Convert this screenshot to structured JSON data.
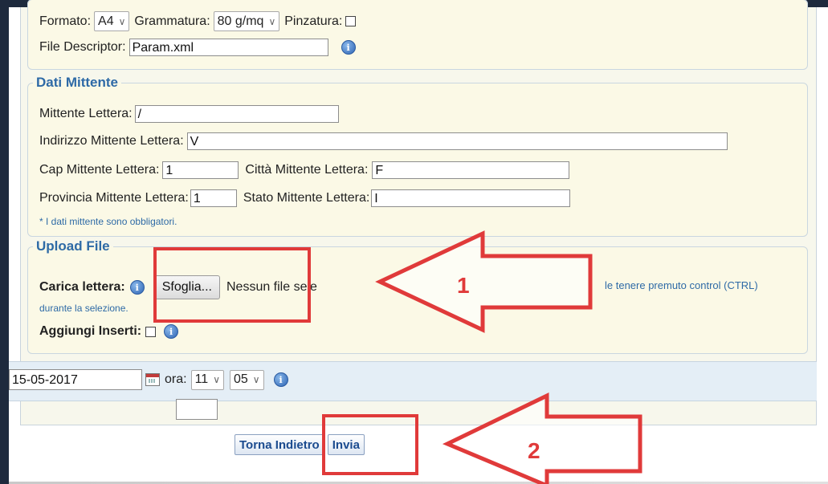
{
  "print_options": {
    "formato_label": "Formato:",
    "formato_value": "A4",
    "grammatura_label": "Grammatura:",
    "grammatura_value": "80 g/mq",
    "pinzatura_label": "Pinzatura:",
    "file_descriptor_label": "File Descriptor:",
    "file_descriptor_value": "Param.xml"
  },
  "dati_mittente": {
    "legend": "Dati Mittente",
    "mittente_label": "Mittente Lettera:",
    "mittente_value": "/",
    "indirizzo_label": "Indirizzo Mittente Lettera:",
    "indirizzo_value": "V",
    "cap_label": "Cap Mittente Lettera:",
    "cap_value": "1",
    "citta_label": "Città Mittente Lettera:",
    "citta_value": "F",
    "provincia_label": "Provincia Mittente Lettera:",
    "provincia_value": "1",
    "stato_label": "Stato Mittente Lettera:",
    "stato_value": "I",
    "note": "* I dati mittente sono obbligatori."
  },
  "upload": {
    "legend": "Upload File",
    "carica_label": "Carica lettera:",
    "browse_button": "Sfoglia...",
    "file_status": "Nessun file sele",
    "hint_right": "le tenere premuto control (CTRL)",
    "hint_continued": "durante la selezione.",
    "inserti_label": "Aggiungi Inserti:"
  },
  "schedule": {
    "date_value": "15-05-2017",
    "ora_label": "ora:",
    "hour_value": "11",
    "minute_value": "05"
  },
  "actions": {
    "back_button": "Torna Indietro",
    "send_button": "Invia"
  },
  "annotations": {
    "arrow1_label": "1",
    "arrow2_label": "2",
    "color": "#e03a3a"
  }
}
